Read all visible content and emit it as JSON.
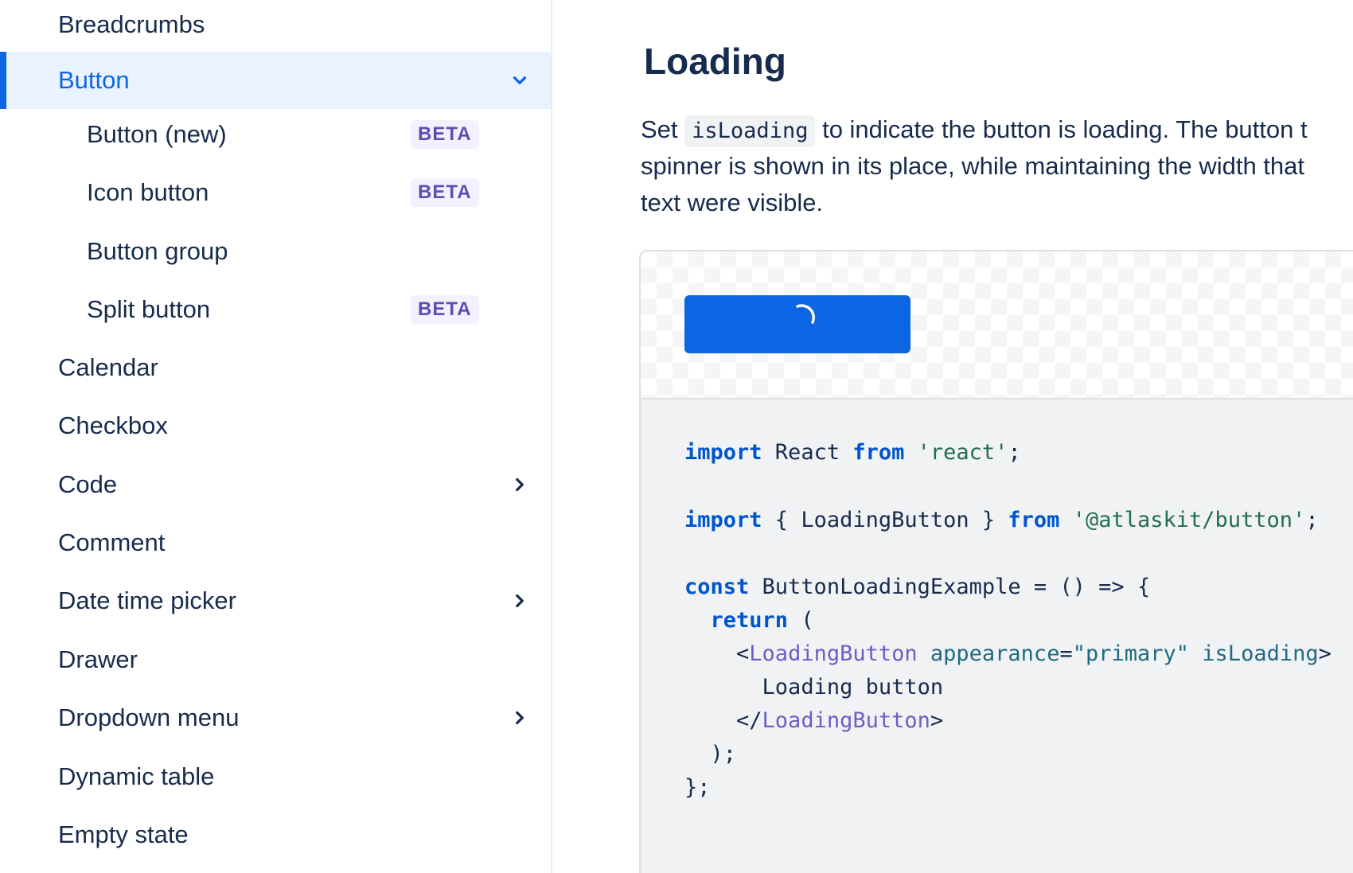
{
  "sidebar": {
    "items": [
      {
        "label": "Breadcrumbs"
      },
      {
        "label": "Button",
        "active": true,
        "expanded": true
      },
      {
        "label": "Button (new)",
        "badge": "BETA"
      },
      {
        "label": "Icon button",
        "badge": "BETA"
      },
      {
        "label": "Button group"
      },
      {
        "label": "Split button",
        "badge": "BETA"
      },
      {
        "label": "Calendar"
      },
      {
        "label": "Checkbox"
      },
      {
        "label": "Code",
        "has_children": true
      },
      {
        "label": "Comment"
      },
      {
        "label": "Date time picker",
        "has_children": true
      },
      {
        "label": "Drawer"
      },
      {
        "label": "Dropdown menu",
        "has_children": true
      },
      {
        "label": "Dynamic table"
      },
      {
        "label": "Empty state"
      }
    ]
  },
  "main": {
    "heading": "Loading",
    "description": {
      "prefix": "Set ",
      "code": "isLoading",
      "line1_rest": " to indicate the button is loading. The button t",
      "line2": "spinner is shown in its place, while maintaining the width that",
      "line3": "text were visible."
    },
    "example": {
      "code": {
        "l1": {
          "kw1": "import",
          "t1": " React ",
          "kw2": "from",
          "t2": " ",
          "str": "'react'",
          "t3": ";"
        },
        "l2": {
          "kw1": "import",
          "t1": " { LoadingButton } ",
          "kw2": "from",
          "t2": " ",
          "str": "'@atlaskit/button'",
          "t3": ";"
        },
        "l3": {
          "kw1": "const",
          "t1": " ButtonLoadingExample = () => {"
        },
        "l4": {
          "indent": "  ",
          "kw1": "return",
          "t1": " ("
        },
        "l5": {
          "indent": "    ",
          "t0": "<",
          "tag": "LoadingButton",
          "sp": " ",
          "attr1": "appearance",
          "eq": "=",
          "val": "\"primary\"",
          "sp2": " ",
          "attr2": "isLoading",
          "t1": ">"
        },
        "l6": {
          "indent": "      ",
          "text": "Loading button"
        },
        "l7": {
          "indent": "    ",
          "t0": "</",
          "tag": "LoadingButton",
          "t1": ">"
        },
        "l8": {
          "indent": "  ",
          "text": ");"
        },
        "l9": {
          "text": "};"
        }
      }
    }
  },
  "colors": {
    "accent": "#0C66E4",
    "active_bg": "#E9F2FF",
    "badge_bg": "#F3F0FF",
    "badge_text": "#5E4DB2",
    "text": "#172B4D"
  }
}
